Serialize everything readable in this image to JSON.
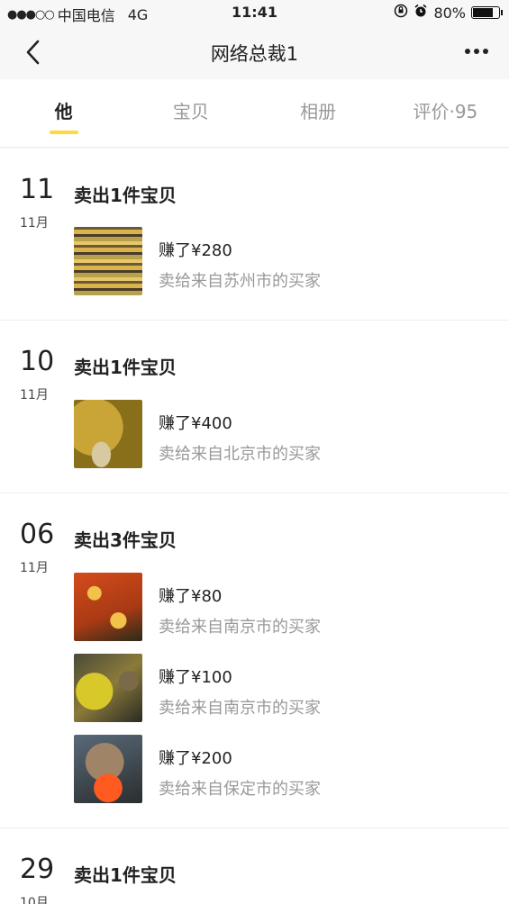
{
  "status": {
    "signal_dots": "●●●○○",
    "carrier": "中国电信",
    "network": "4G",
    "time": "11:41",
    "battery_percent": "80%",
    "battery_level": 0.8
  },
  "nav": {
    "title": "网络总裁1"
  },
  "tabs": [
    {
      "label": "他",
      "active": true
    },
    {
      "label": "宝贝",
      "active": false
    },
    {
      "label": "相册",
      "active": false
    },
    {
      "label": "评价·95",
      "active": false
    }
  ],
  "feed": [
    {
      "day": "11",
      "month": "11月",
      "headline": "卖出1件宝贝",
      "sales": [
        {
          "amount": "赚了¥280",
          "buyer": "卖给来自苏州市的买家"
        }
      ]
    },
    {
      "day": "10",
      "month": "11月",
      "headline": "卖出1件宝贝",
      "sales": [
        {
          "amount": "赚了¥400",
          "buyer": "卖给来自北京市的买家"
        }
      ]
    },
    {
      "day": "06",
      "month": "11月",
      "headline": "卖出3件宝贝",
      "sales": [
        {
          "amount": "赚了¥80",
          "buyer": "卖给来自南京市的买家"
        },
        {
          "amount": "赚了¥100",
          "buyer": "卖给来自南京市的买家"
        },
        {
          "amount": "赚了¥200",
          "buyer": "卖给来自保定市的买家"
        }
      ]
    },
    {
      "day": "29",
      "month": "10月",
      "headline": "卖出1件宝贝",
      "sales": []
    }
  ]
}
